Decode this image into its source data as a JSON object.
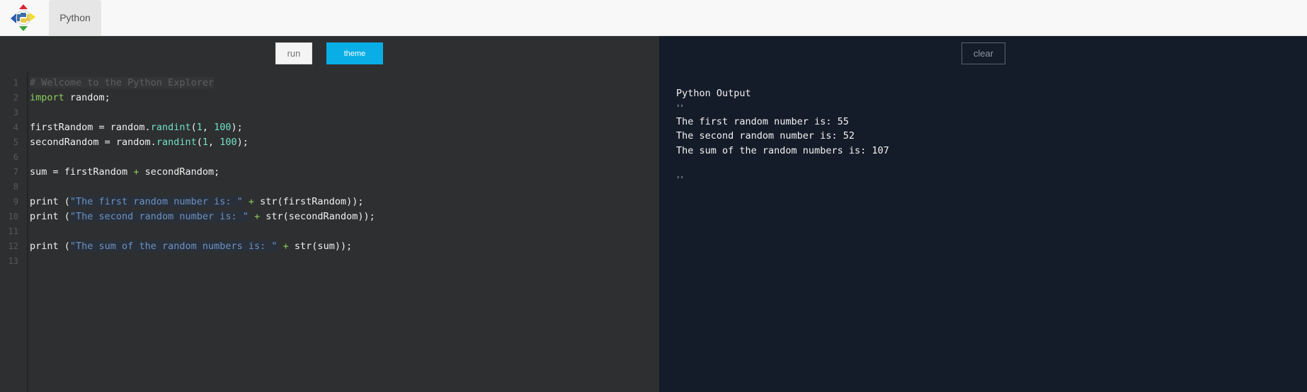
{
  "header": {
    "logo_name": "python-explorer-logo",
    "tabs": [
      {
        "label": "Python"
      }
    ]
  },
  "toolbar": {
    "run_label": "run",
    "theme_label": "theme",
    "clear_label": "clear"
  },
  "editor": {
    "line_numbers": [
      "1",
      "2",
      "3",
      "4",
      "5",
      "6",
      "7",
      "8",
      "9",
      "10",
      "11",
      "12",
      "13"
    ],
    "lines": [
      "# Welcome to the Python Explorer",
      "import random;",
      "",
      "firstRandom = random.randint(1, 100);",
      "secondRandom = random.randint(1, 100);",
      "",
      "sum = firstRandom + secondRandom;",
      "",
      "print (\"The first random number is: \" + str(firstRandom));",
      "print (\"The second random number is: \" + str(secondRandom));",
      "",
      "print (\"The sum of the random numbers is: \" + str(sum));",
      ""
    ]
  },
  "output": {
    "title": "Python Output",
    "prompt": "››",
    "lines": [
      "The first random number is: 55",
      "The second random number is: 52",
      "The sum of the random numbers is: 107"
    ],
    "end_prompt": "››"
  },
  "colors": {
    "theme_button": "#0aaee6",
    "editor_bg": "#2e2f30",
    "output_bg": "#151c29",
    "keyword": "#8bcf5c",
    "function": "#6fe1c7",
    "string": "#6b91c4"
  }
}
